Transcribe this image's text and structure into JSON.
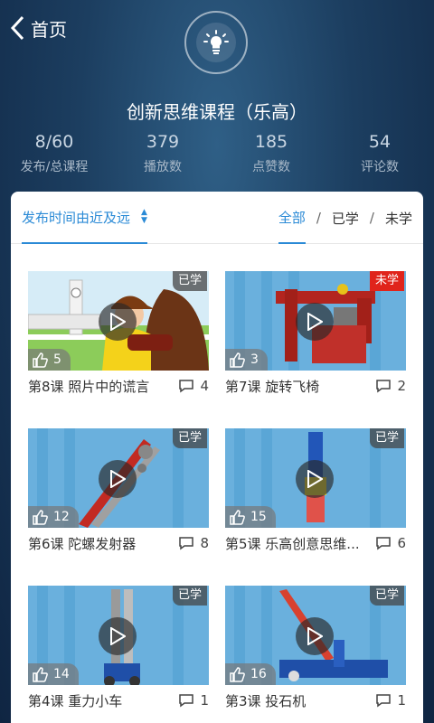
{
  "nav": {
    "back_label": "首页"
  },
  "course": {
    "title": "创新思维课程（乐高）"
  },
  "stats": [
    {
      "value": "8/60",
      "label": "发布/总课程"
    },
    {
      "value": "379",
      "label": "播放数"
    },
    {
      "value": "185",
      "label": "点赞数"
    },
    {
      "value": "54",
      "label": "评论数"
    }
  ],
  "filter": {
    "sort_label": "发布时间由近及远",
    "tabs": [
      "全部",
      "已学",
      "未学"
    ],
    "active_tab": "全部"
  },
  "lessons": [
    {
      "title": "第8课  照片中的谎言",
      "status": "已学",
      "likes": "5",
      "comments": "4"
    },
    {
      "title": "第7课  旋转飞椅",
      "status": "未学",
      "likes": "3",
      "comments": "2"
    },
    {
      "title": "第6课  陀螺发射器",
      "status": "已学",
      "likes": "12",
      "comments": "8"
    },
    {
      "title": "第5课  乐高创意思维...",
      "status": "已学",
      "likes": "15",
      "comments": "6"
    },
    {
      "title": "第4课  重力小车",
      "status": "已学",
      "likes": "14",
      "comments": "1"
    },
    {
      "title": "第3课  投石机",
      "status": "已学",
      "likes": "16",
      "comments": "1"
    }
  ],
  "colors": {
    "accent": "#2a8ad6",
    "unlearned_badge": "#e0241b"
  }
}
